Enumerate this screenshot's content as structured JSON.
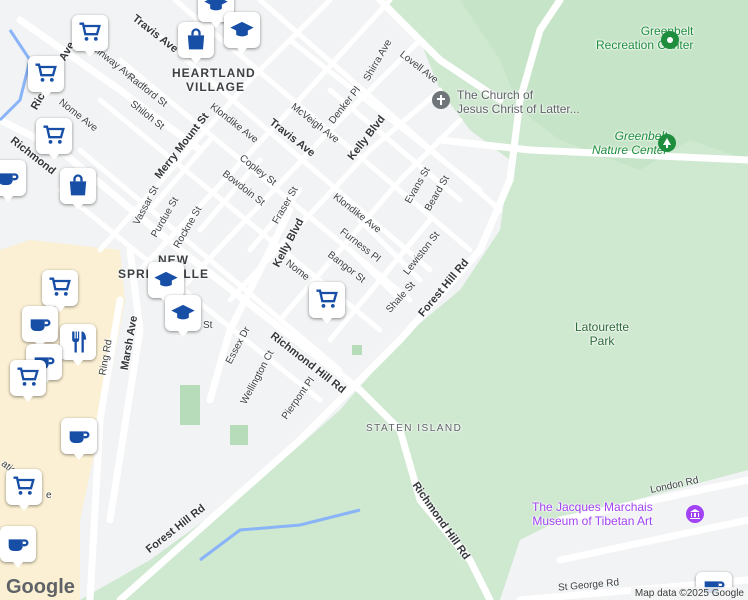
{
  "colors": {
    "park": "#cfe8d0",
    "park_dark": "#b7dcb9",
    "urban": "#f1f3f4",
    "commercial": "#fbf0d3",
    "road": "#ffffff",
    "road_casing": "#dadce0",
    "water": "#8ab4f8",
    "pin_icon": "#174ea6"
  },
  "areas": {
    "heartland_village_line1": "HEARTLAND",
    "heartland_village_line2": "VILLAGE",
    "new_springville_line1": "NEW",
    "new_springville_line2": "SPRINGVILLE",
    "staten_island": "STATEN ISLAND"
  },
  "streets": {
    "travis_ave_1": "Travis Ave",
    "travis_ave_2": "Travis Ave",
    "steinway_ave": "Steinway Ave",
    "richmond_ave": "Richmond Ave",
    "nome_ave": "Nome Ave",
    "radford_st": "Radford St",
    "shiloh_st": "Shiloh St",
    "merry_mount_st": "Merry Mount St",
    "klondike_ave_1": "Klondike Ave",
    "klondike_ave_2": "Klondike Ave",
    "mcveigh_ave": "McVeigh Ave",
    "denker_pl": "Denker Pl",
    "kelly_blvd_1": "Kelly Blvd",
    "kelly_blvd_2": "Kelly Blvd",
    "shirra_ave": "Shirra Ave",
    "lovell_ave": "Lovell Ave",
    "copley_st": "Copley St",
    "bowdoin_st": "Bowdoin St",
    "fraser_st": "Fraser St",
    "vassar_st": "Vassar St",
    "purdue_st": "Purdue St",
    "rockne_st": "Rockne St",
    "evans_st": "Evans St",
    "beard_st": "Beard St",
    "furness_pl": "Furness Pl",
    "lewiston_st": "Lewiston St",
    "bangor_st": "Bangor St",
    "nome": "Nome",
    "shale_st": "Shale St",
    "forest_hill_rd_1": "Forest Hill Rd",
    "forest_hill_rd_2": "Forest Hill Rd",
    "richmond_hill_rd_1": "Richmond Hill Rd",
    "richmond_hill_rd_2": "Richmond Hill Rd",
    "essex_dr": "Essex Dr",
    "wellington_ct": "Wellington Ct",
    "pierpont_pl": "Pierpont Pl",
    "marsh_ave": "Marsh Ave",
    "ring_rd": "Ring Rd",
    "london_rd": "London Rd",
    "st_george_rd": "St George Rd",
    "richmond_short": "Richmond",
    "ation": "ation",
    "e": "e",
    "st": "St"
  },
  "pois": {
    "greenbelt_rec_line1": "Greenbelt",
    "greenbelt_rec_line2": "Recreation Center",
    "church_line1": "The Church of",
    "church_line2": "Jesus Christ of Latter...",
    "nature_center_line1": "Greenbelt",
    "nature_center_line2": "Nature Center",
    "latourette_line1": "Latourette",
    "latourette_line2": "Park",
    "museum_line1": "The Jacques Marchais",
    "museum_line2": "Museum of Tibetan Art"
  },
  "markers": [
    "shopping-cart",
    "shopping-bag",
    "graduation-cap",
    "coffee-cup",
    "restaurant"
  ],
  "footer": {
    "logo": "Google",
    "attribution": "Map data ©2025 Google"
  }
}
